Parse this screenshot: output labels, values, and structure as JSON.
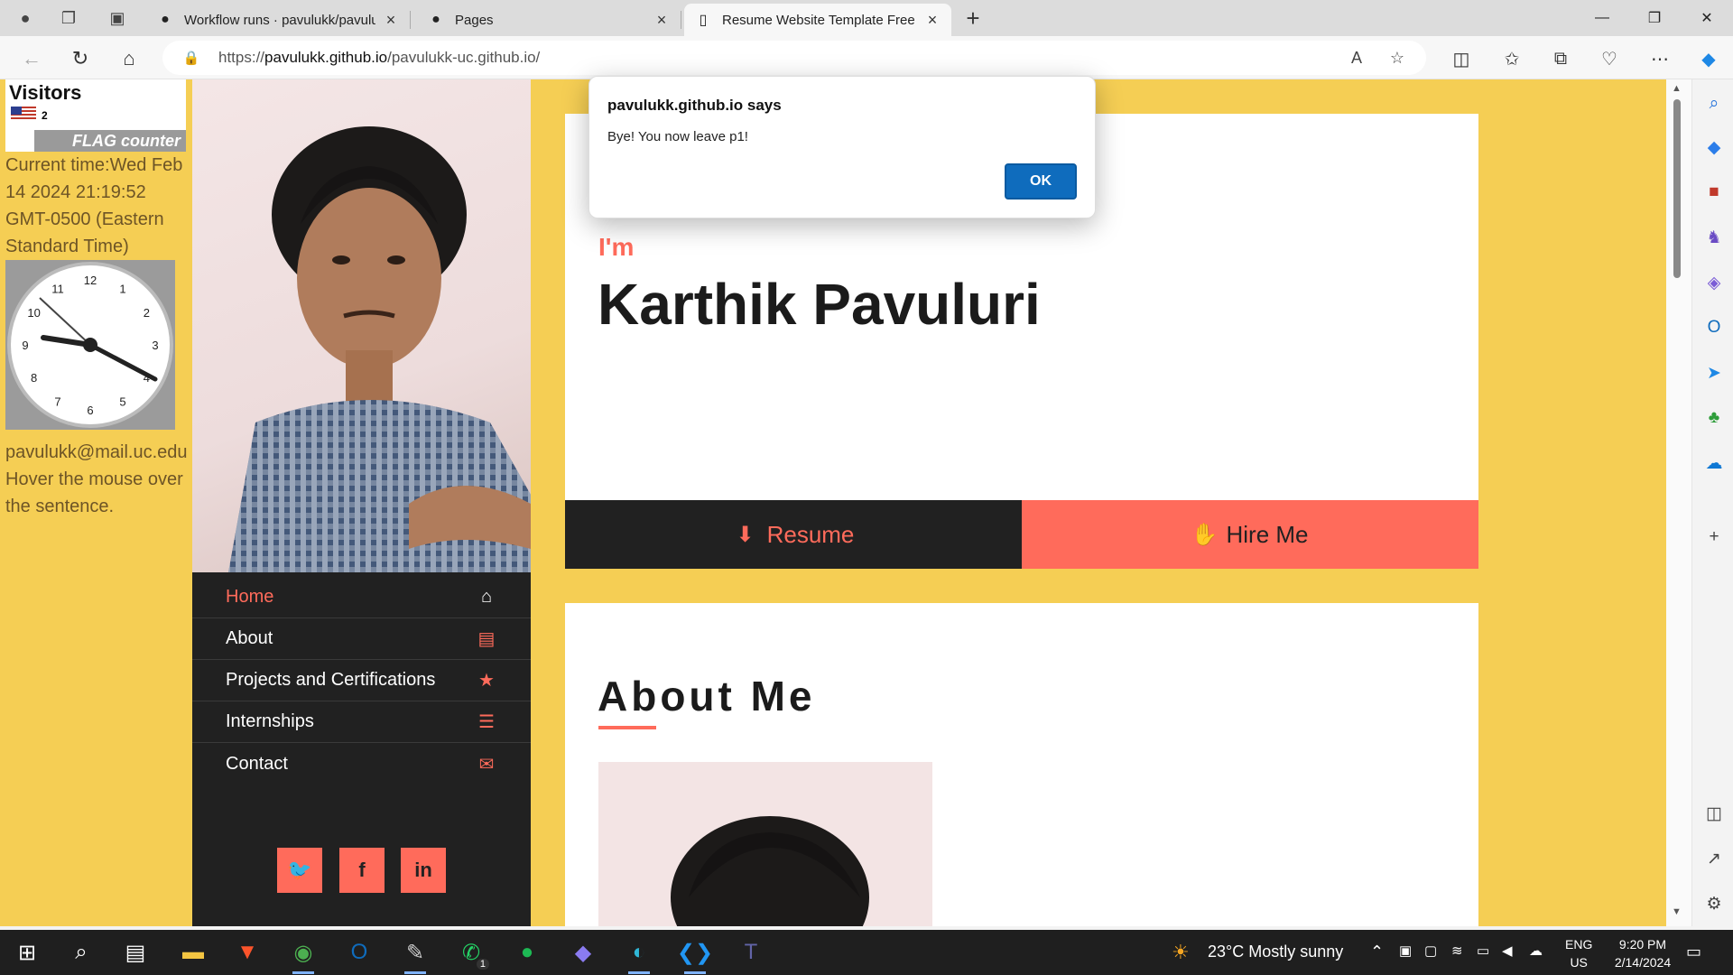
{
  "browser": {
    "tabs": [
      {
        "title": "Workflow runs · pavulukk/pavulu",
        "icon": "github-icon",
        "active": false
      },
      {
        "title": "Pages",
        "icon": "github-icon",
        "active": false
      },
      {
        "title": "Resume Website Template Free D",
        "icon": "page-icon",
        "active": true
      }
    ],
    "url_prefix": "https://",
    "url_host": "pavulukk.github.io",
    "url_path": "/pavulukk-uc.github.io/"
  },
  "widgets": {
    "visitors_title": "Visitors",
    "visitor_count": "2",
    "flag_counter_label": "FLAG counter",
    "current_time": "Current time:Wed Feb 14 2024 21:19:52 GMT-0500 (Eastern Standard Time)",
    "clock_numbers": [
      "12",
      "1",
      "2",
      "3",
      "4",
      "5",
      "6",
      "7",
      "8",
      "9",
      "10",
      "11"
    ],
    "email": "pavulukk@mail.uc.edu",
    "hover_note": "Hover the mouse over the sentence."
  },
  "sidebar": {
    "menu": [
      {
        "label": "Home",
        "icon": "home-icon",
        "active": true
      },
      {
        "label": "About",
        "icon": "id-card-icon",
        "active": false
      },
      {
        "label": "Projects and Certifications",
        "icon": "star-icon",
        "active": false
      },
      {
        "label": "Internships",
        "icon": "list-icon",
        "active": false
      },
      {
        "label": "Contact",
        "icon": "envelope-icon",
        "active": false
      }
    ],
    "social": [
      {
        "name": "twitter",
        "glyph": "🐦"
      },
      {
        "name": "facebook",
        "glyph": "f"
      },
      {
        "name": "linkedin",
        "glyph": "in"
      }
    ]
  },
  "hero": {
    "intro": "I'm",
    "name": "Karthik Pavuluri",
    "resume_label": "Resume",
    "hire_label": "Hire Me"
  },
  "about": {
    "heading": "About Me"
  },
  "alert": {
    "title": "pavulukk.github.io says",
    "message": "Bye! You now leave p1!",
    "ok_label": "OK"
  },
  "taskbar": {
    "weather": "23°C  Mostly sunny",
    "lang_line1": "ENG",
    "lang_line2": "US",
    "time": "9:20 PM",
    "date": "2/14/2024",
    "whatsapp_badge": "1"
  },
  "colors": {
    "page_bg": "#f5ce54",
    "accent": "#ff6b5b",
    "dark": "#212121"
  }
}
